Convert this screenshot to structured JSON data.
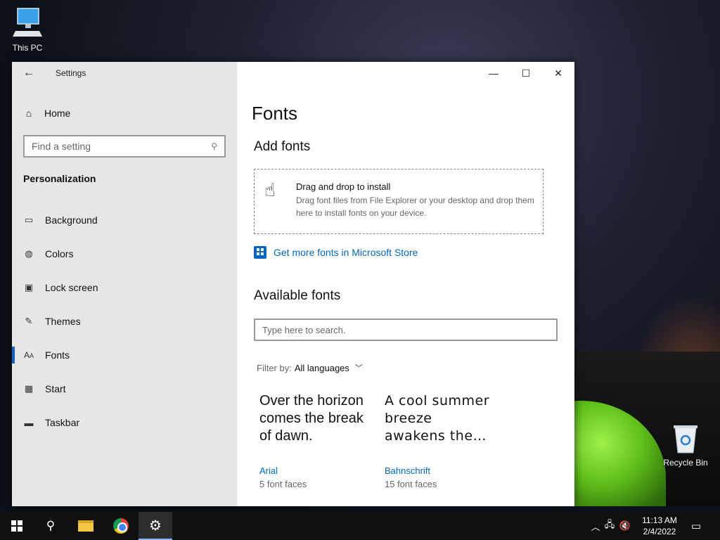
{
  "desktop": {
    "icons": [
      {
        "label": "This PC"
      },
      {
        "label": "Recycle Bin"
      }
    ]
  },
  "window": {
    "app_title": "Settings",
    "sidebar": {
      "home_label": "Home",
      "search_placeholder": "Find a setting",
      "section_title": "Personalization",
      "items": [
        {
          "label": "Background",
          "icon": "image-icon"
        },
        {
          "label": "Colors",
          "icon": "palette-icon"
        },
        {
          "label": "Lock screen",
          "icon": "lock-screen-icon"
        },
        {
          "label": "Themes",
          "icon": "brush-icon"
        },
        {
          "label": "Fonts",
          "icon": "font-icon",
          "active": true
        },
        {
          "label": "Start",
          "icon": "start-icon"
        },
        {
          "label": "Taskbar",
          "icon": "taskbar-icon"
        }
      ]
    },
    "main": {
      "page_title": "Fonts",
      "add_fonts_heading": "Add fonts",
      "drop_zone": {
        "title": "Drag and drop to install",
        "description": "Drag font files from File Explorer or your desktop and drop them here to install fonts on your device."
      },
      "store_link": "Get more fonts in Microsoft Store",
      "available_heading": "Available fonts",
      "font_search_placeholder": "Type here to search.",
      "filter_label": "Filter by:",
      "filter_value": "All languages",
      "fonts": [
        {
          "sample": "Over the horizon comes the break of dawn.",
          "name": "Arial",
          "faces": "5 font faces"
        },
        {
          "sample": "A cool summer breeze awakens the…",
          "name": "Bahnschrift",
          "faces": "15 font faces"
        }
      ]
    }
  },
  "taskbar": {
    "time": "11:13 AM",
    "date": "2/4/2022"
  },
  "colors": {
    "accent": "#0067c0",
    "sidebar_bg": "#e6e6e6"
  }
}
